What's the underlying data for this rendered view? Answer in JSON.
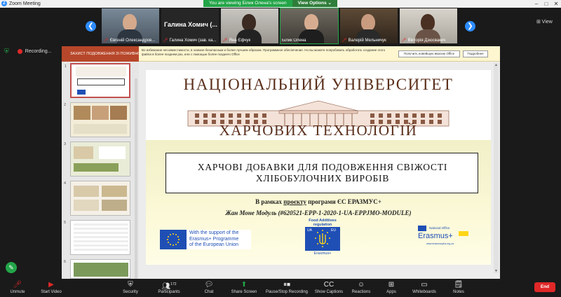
{
  "window": {
    "title": "Zoom Meeting",
    "logo_letter": "Z"
  },
  "banner": {
    "message": "You are viewing Білик Олена's screen",
    "view_options": "View Options ⌄"
  },
  "gallery": {
    "label": "⊞ View"
  },
  "participants": [
    {
      "name": "Євгеній Олександров...",
      "muted": true
    },
    {
      "name": "Галина Хомич (зав. ка...",
      "muted": true,
      "big_label": "Галина Хомич (...",
      "active": true
    },
    {
      "name": "Яна Єфчук",
      "muted": true
    },
    {
      "name": "Білик Олена",
      "muted": false
    },
    {
      "name": "Валерій Мельничук",
      "muted": true
    },
    {
      "name": "Вікторія Дзюсвакич",
      "muted": true
    }
  ],
  "recording": {
    "label": "Recording..."
  },
  "powerpoint": {
    "doc_title": "ЗАХИСТ ПОДОВЖЕННЯ ЗІ ПОЖИВНОГО...",
    "warning_line1": "Во избежание несовместимости, в эсквизе безопасным и более лучшем образом. Программное обеспечение. Но вы можете попробовать обработать создание этого",
    "warning_line2": "файла в более позднем раз, или с помощью более позднего Office",
    "btn_office": "Получить новейшую версию Office",
    "btn_close": "Подробнее",
    "thumb_numbers": [
      "1",
      "2",
      "3",
      "4",
      "5",
      "6"
    ]
  },
  "slide": {
    "university_line1": "НАЦІОНАЛЬНИЙ УНІВЕРСИТЕТ",
    "university_line2": "ХАРЧОВИХ ТЕХНОЛОГІЙ",
    "title_line1": "ХАРЧОВІ ДОБАВКИ ДЛЯ ПОДОВЖЕННЯ СВІЖОСТІ",
    "title_line2": "ХЛІБОБУЛОЧНИХ ВИРОБІВ",
    "project_prefix": "В рамках ",
    "project_underlined": "проєкту",
    "project_suffix": " програми ЄС ЕРАЗМУС+",
    "module_line": "Жан Моне Модуль (#620521-EPP-1-2020-1-UA-EPPJMO-MODULE)",
    "eu_support_line1": "With the support of the",
    "eu_support_line2": "Erasmus+ Programme",
    "eu_support_line3": "of the European Union",
    "fa_caption_line1": "Food Additives",
    "fa_caption_line2": "regulation",
    "fa_ua": "UA",
    "fa_eu": "EU",
    "fa_erasmus": "Erasmus+",
    "no_small": "National Office",
    "no_erasmus": "Erasmus+",
    "no_url": "www.erasmusplus.org.ua"
  },
  "toolbar": {
    "unmute": "Unmute",
    "start_video": "Start Video",
    "security": "Security",
    "participants": "Participants",
    "participants_count": "172",
    "chat": "Chat",
    "share_screen": "Share Screen",
    "record": "Pause/Stop Recording",
    "captions": "Show Captions",
    "reactions": "Reactions",
    "apps": "Apps",
    "whiteboards": "Whiteboards",
    "notes": "Notes",
    "end": "End"
  },
  "colors": {
    "accent": "#2d8cff",
    "green": "#23a548",
    "red": "#e02828",
    "slide_title": "#5a2e1a"
  }
}
